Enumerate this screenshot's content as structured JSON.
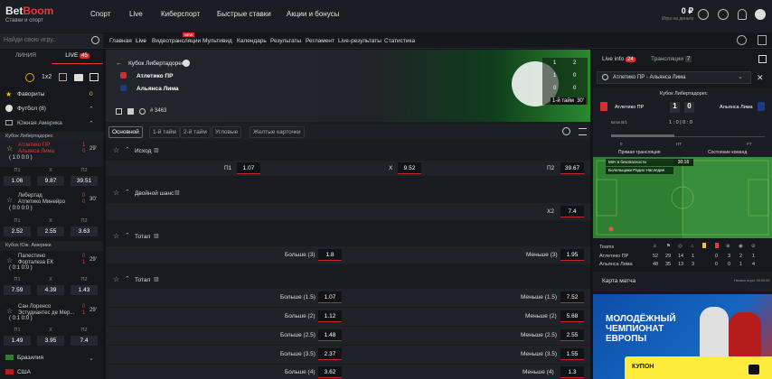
{
  "brand": {
    "name_a": "Bet",
    "name_b": "Boom",
    "tagline": "Ставки и спорт"
  },
  "nav": [
    "Спорт",
    "Live",
    "Киберспорт",
    "Быстрые ставки",
    "Акции и бонусы"
  ],
  "balance": {
    "value": "0 ₽",
    "caption": "Игра на деньги"
  },
  "search": {
    "placeholder": "Найди свою игру.."
  },
  "breadcrumbs": [
    "Главная",
    "Live",
    "Видеотрансляции",
    "Мультивид",
    "Календарь",
    "Результаты",
    "Регламент",
    "Live-результаты",
    "Статистика"
  ],
  "new_badge": "NEW",
  "left": {
    "tabs": [
      {
        "label": "ЛИНИЯ"
      },
      {
        "label": "LIVE",
        "count": "45"
      }
    ],
    "odd_format": "1x2",
    "favorites": {
      "label": "Фавориты",
      "count": "0"
    },
    "football": {
      "label": "Футбол (8)"
    },
    "region": "Южная Америка",
    "group1": "Кубок Либертадорес",
    "group2": "Кубок Юж. Америки",
    "brazil": "Бразилия",
    "usa": "США",
    "matches": [
      {
        "t1": "Атлетико ПР",
        "t2": "Альянса Лима",
        "s1": "1",
        "s2": "0",
        "score": "( 1:0  0:0 )",
        "time": "29'",
        "odds": [
          "1.06",
          "9.87",
          "39.51"
        ],
        "active": true
      },
      {
        "t1": "Либертад",
        "t2": "Атлетико Минейро",
        "s1": "0",
        "s2": "0",
        "score": "( 0:0  0:0 )",
        "time": "30'",
        "odds": [
          "2.52",
          "2.55",
          "3.63"
        ],
        "active": false
      },
      {
        "t1": "Палестино",
        "t2": "Форталеза ЕК",
        "s1": "0",
        "s2": "1",
        "score": "( 0:1  0:0 )",
        "time": "29'",
        "odds": [
          "7.59",
          "4.39",
          "1.43"
        ],
        "active": false
      },
      {
        "t1": "Сан Лоренсо",
        "t2": "Эстудиантес де Мер...",
        "s1": "0",
        "s2": "1",
        "score": "( 0:1  0:0 )",
        "time": "29'",
        "odds": [
          "1.49",
          "3.95",
          "7.4"
        ],
        "active": false
      }
    ],
    "odd_keys": [
      "П1",
      "Х",
      "П2"
    ]
  },
  "hero": {
    "league": "Кубок Либертадорес",
    "team1": "Атлетико ПР",
    "team2": "Альянса Лима",
    "code": "# 3463",
    "period": "1-й тайм",
    "minute": "30'",
    "cols": [
      "1",
      "2"
    ],
    "rows": [
      [
        "1",
        "0"
      ],
      [
        "0",
        "0"
      ]
    ]
  },
  "center_tabs": [
    "Основной",
    "1-й тайм",
    "2-й тайм",
    "Угловые",
    "Желтые карточки"
  ],
  "markets": [
    {
      "title": "Исход",
      "lines": [
        {
          "l": "П1",
          "v": "1.07"
        },
        {
          "l": "Х",
          "v": "9.52"
        },
        {
          "l": "П2",
          "v": "39.67"
        }
      ]
    },
    {
      "title": "Двойной шанс",
      "lines": [
        {
          "l": "Х2",
          "v": "7.4"
        }
      ]
    },
    {
      "title": "Тотал",
      "rows": [
        {
          "a": "Больше (3)",
          "av": "1.8",
          "b": "Меньше (3)",
          "bv": "1.95"
        }
      ]
    },
    {
      "title": "Тотал",
      "rows": [
        {
          "a": "Больше (1.5)",
          "av": "1.07",
          "b": "Меньше (1.5)",
          "bv": "7.52"
        },
        {
          "a": "Больше (2)",
          "av": "1.12",
          "b": "Меньше (2)",
          "bv": "5.68"
        },
        {
          "a": "Больше (2.5)",
          "av": "1.48",
          "b": "Меньше (2.5)",
          "bv": "2.55"
        },
        {
          "a": "Больше (3.5)",
          "av": "2.37",
          "b": "Меньше (3.5)",
          "bv": "1.55"
        },
        {
          "a": "Больше (4)",
          "av": "3.62",
          "b": "Меньше (4)",
          "bv": "1.3"
        }
      ]
    }
  ],
  "right": {
    "tab1": "Live info",
    "tab1_count": "24",
    "tab2": "Трансляции",
    "tab2_count": "7",
    "select": "Атлетико ПР - Альянса Лима",
    "league": "Кубок Либертадорес",
    "t1": "Атлетико ПР",
    "t2": "Альянса Лима",
    "s1": "1",
    "s2": "0",
    "row1_label": "Блок В/1",
    "row1_val": "1 : 0 | 0 : 0",
    "ticks": [
      "0",
      "HT",
      "FT"
    ],
    "links": [
      "Прямая трансляция",
      "Состояние команд"
    ],
    "commentary": [
      "Мяч в безопасности",
      "Болельщики Радио Наследие"
    ],
    "clock": "30:16",
    "stats_header": "Teams",
    "stats": [
      {
        "team": "Атлетико ПР",
        "vals": [
          "52",
          "29",
          "14",
          "1",
          "0",
          "3",
          "2",
          "1"
        ]
      },
      {
        "team": "Альянса Лима",
        "vals": [
          "48",
          "35",
          "13",
          "3",
          "0",
          "0",
          "1",
          "4"
        ]
      }
    ],
    "map_label": "Карта матча",
    "map_note": "Начало игры: 00:00:00",
    "promo": "МОЛОДЁЖНЫЙ ЧЕМПИОНАТ ЕВРОПЫ",
    "kupon": "КУПОН"
  },
  "colors": {
    "accent": "#e53935",
    "kupon": "#ffeb3b",
    "pitch": "#2e7d32"
  }
}
